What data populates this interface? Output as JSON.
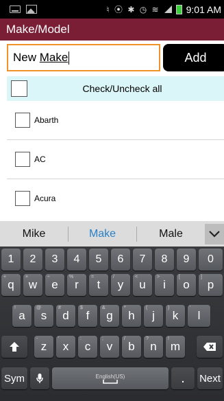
{
  "status_bar": {
    "time": "9:01 AM",
    "icons": "♮ ⦿ ✱ ◷ ≋"
  },
  "title": "Make/Model",
  "input": {
    "value_plain": "New ",
    "value_underlined": "Make"
  },
  "add_button": "Add",
  "check_all": "Check/Uncheck all",
  "makes": [
    "Abarth",
    "AC",
    "Acura"
  ],
  "suggestions": [
    "Mike",
    "Make",
    "Male"
  ],
  "keyboard": {
    "numbers": [
      "1",
      "2",
      "3",
      "4",
      "5",
      "6",
      "7",
      "8",
      "9",
      "0"
    ],
    "row1": [
      "q",
      "w",
      "e",
      "r",
      "t",
      "y",
      "u",
      "i",
      "o",
      "p"
    ],
    "row1_sup": [
      "+",
      "×",
      "÷",
      "%",
      "=",
      "/",
      "<",
      ">",
      "[",
      "]"
    ],
    "row2": [
      "a",
      "s",
      "d",
      "f",
      "g",
      "h",
      "j",
      "k",
      "l"
    ],
    "row2_sup": [
      "!",
      "@",
      "#",
      "$",
      "&",
      "*",
      "(",
      ")",
      "'"
    ],
    "row3": [
      "z",
      "x",
      "c",
      "v",
      "b",
      "n",
      "m"
    ],
    "row3_sup": [
      "-",
      "'",
      ":",
      ";",
      "/",
      "?",
      "!"
    ],
    "sym": "Sym",
    "space_label": "English(US)",
    "next": "Next"
  }
}
